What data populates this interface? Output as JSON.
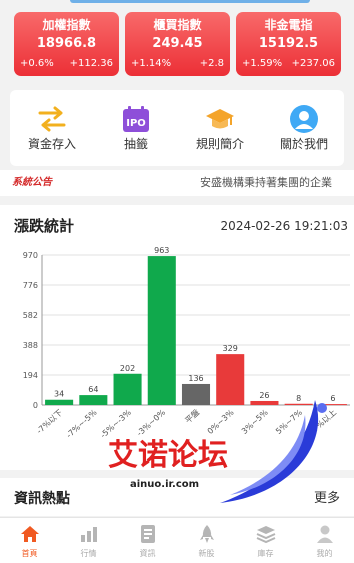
{
  "index_cards": [
    {
      "name": "加權指數",
      "value": "18966.8",
      "pct": "+0.6%",
      "diff": "+112.36"
    },
    {
      "name": "櫃買指數",
      "value": "249.45",
      "pct": "+1.14%",
      "diff": "+2.8"
    },
    {
      "name": "非金電指",
      "value": "15192.5",
      "pct": "+1.59%",
      "diff": "+237.06"
    }
  ],
  "menu": [
    {
      "label": "資金存入",
      "icon": "transfer-arrows-icon"
    },
    {
      "label": "抽籤",
      "icon": "ipo-calendar-icon"
    },
    {
      "label": "規則簡介",
      "icon": "graduation-cap-icon"
    },
    {
      "label": "關於我們",
      "icon": "user-circle-icon"
    }
  ],
  "menu_ipo_text": "IPO",
  "notice": {
    "tag": "系統公告",
    "message": "安盛機構秉持著集團的企業"
  },
  "stats": {
    "title": "漲跌統計",
    "timestamp": "2024-02-26 19:21:03"
  },
  "chart_data": {
    "type": "bar",
    "categories": [
      "-7%以下",
      "-7%~-5%",
      "-5%~-3%",
      "-3%~0%",
      "平盤",
      "0%~3%",
      "3%~5%",
      "5%~7%",
      "7%以上"
    ],
    "values": [
      34,
      64,
      202,
      963,
      136,
      329,
      26,
      8,
      6
    ],
    "bar_colors": [
      "#10a94c",
      "#10a94c",
      "#10a94c",
      "#10a94c",
      "#666666",
      "#e83a3a",
      "#e83a3a",
      "#e83a3a",
      "#e83a3a"
    ],
    "yticks": [
      0,
      194,
      388,
      582,
      776,
      970
    ],
    "ylim": [
      0,
      970
    ],
    "grid": true
  },
  "news": {
    "title": "資訊熱點",
    "more": "更多"
  },
  "watermark": {
    "text": "艾诺论坛",
    "url": "ainuo.ir.com"
  },
  "tabbar": [
    {
      "label": "首頁",
      "icon": "home-icon",
      "active": true
    },
    {
      "label": "行情",
      "icon": "bar-chart-icon",
      "active": false
    },
    {
      "label": "資訊",
      "icon": "document-icon",
      "active": false
    },
    {
      "label": "新股",
      "icon": "rocket-icon",
      "active": false
    },
    {
      "label": "庫存",
      "icon": "layers-icon",
      "active": false
    },
    {
      "label": "我的",
      "icon": "user-icon",
      "active": false
    }
  ],
  "colors": {
    "up": "#e83a3a",
    "down": "#10a94c",
    "flat": "#666666",
    "accent": "#f05a22",
    "card": "#ec2f36"
  }
}
